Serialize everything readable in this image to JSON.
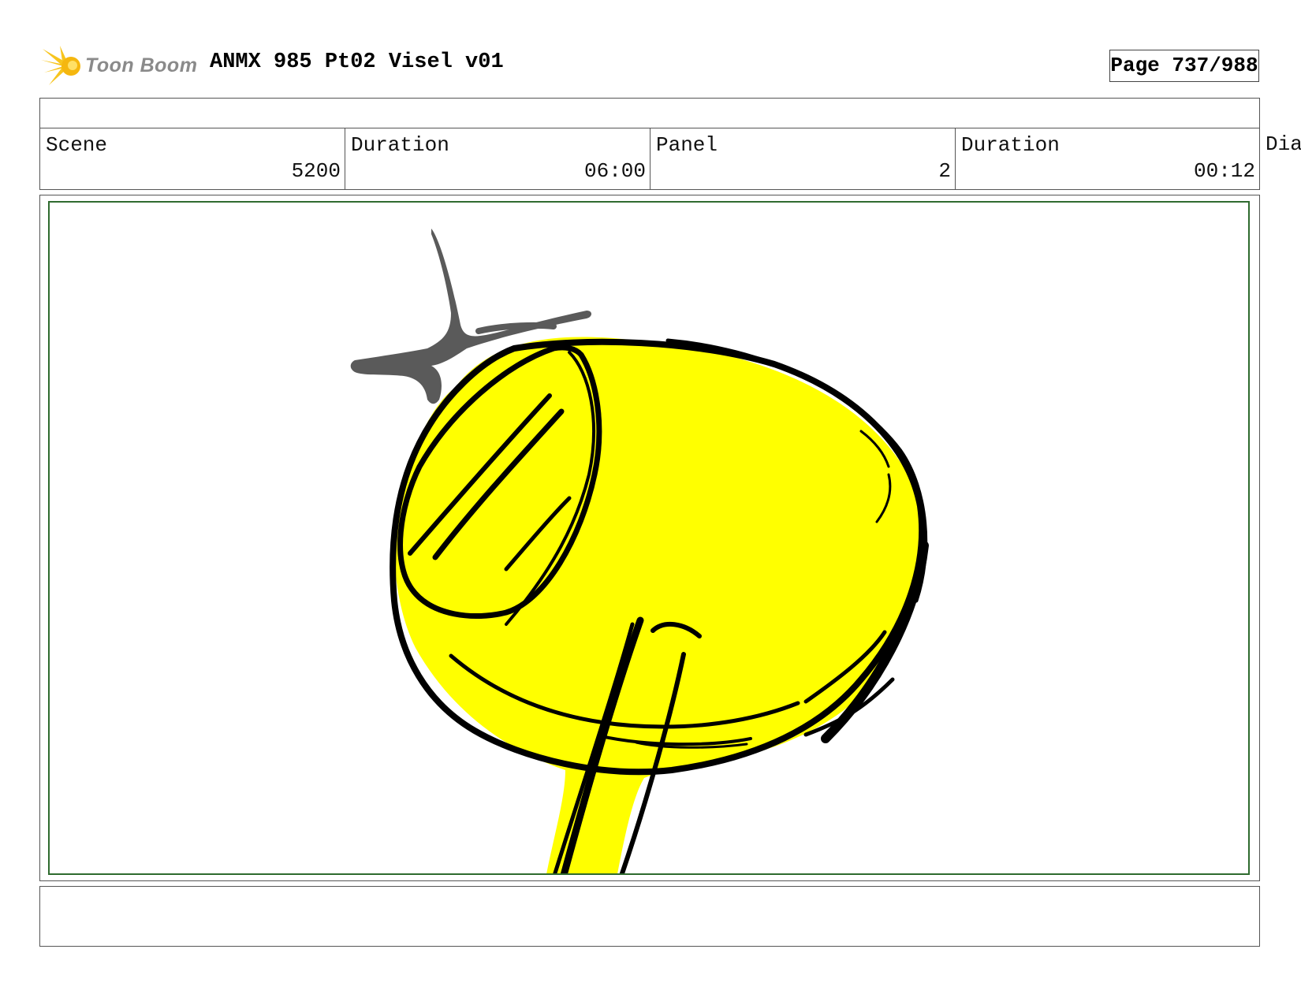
{
  "header": {
    "logo_text": "Toon Boom",
    "doc_title": "ANMX 985 Pt02 Visel v01",
    "page_label": "Page 737/988"
  },
  "info": {
    "scene_label": "Scene",
    "scene_value": "5200",
    "scene_duration_label": "Duration",
    "scene_duration_value": "06:00",
    "panel_label": "Panel",
    "panel_value": "2",
    "panel_duration_label": "Duration",
    "panel_duration_value": "00:12",
    "dialogue_label": "Dia"
  },
  "colors": {
    "fill": "#ffff00",
    "ink": "#000000",
    "sparkle": "#5a5a5a",
    "frame": "#2f6b2f",
    "logo_star": "#f7c51e"
  }
}
